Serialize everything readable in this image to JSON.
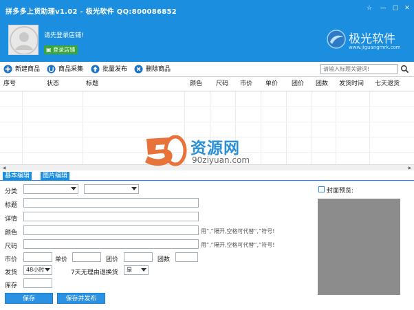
{
  "window": {
    "title": "拼多多上货助理v1.02 - 极光软件  QQ:800086852",
    "settings_glyph": "☆",
    "minimize_glyph": "—",
    "maximize_glyph": "□",
    "close_glyph": "✕"
  },
  "header": {
    "login_tip": "请先登录店铺!",
    "login_button": "登录店铺",
    "brand_name": "极光软件",
    "brand_url": "www.jiguangmrk.com"
  },
  "toolbar": {
    "add": "新建商品",
    "collect": "商品采集",
    "publish": "批量发布",
    "delete": "删除商品",
    "search_placeholder": "请输入标题关键词!"
  },
  "table": {
    "columns": [
      "序号",
      "状态",
      "标题",
      "颜色",
      "尺码",
      "市价",
      "单价",
      "团价",
      "团数",
      "发货时间",
      "七天退货"
    ]
  },
  "watermark": {
    "cn": "资源网",
    "url": "90ziyuan.com"
  },
  "tabs": {
    "basic": "基本编辑",
    "image": "图片编辑"
  },
  "form": {
    "category_label": "分类",
    "title_label": "标题",
    "detail_label": "详情",
    "color_label": "颜色",
    "color_hint": "用“,”隔开,空格可代替“,”符号!",
    "size_label": "尺码",
    "size_hint": "用“,”隔开,空格可代替“,”符号!",
    "market_price_label": "市价",
    "unit_price_label": "单价",
    "group_price_label": "团价",
    "group_count_label": "团数",
    "ship_label": "发货",
    "ship_value": "48小时",
    "return_label": "7天无理由退换货",
    "return_value": "是",
    "stock_label": "库存",
    "save_button": "保存",
    "save_publish_button": "保存并发布",
    "preview_label": "封面预览:"
  },
  "colors": {
    "accent": "#1c8ee0",
    "button": "#2b92e3",
    "login_green": "#3aa53a",
    "preview_gray": "#8c8c8c"
  }
}
